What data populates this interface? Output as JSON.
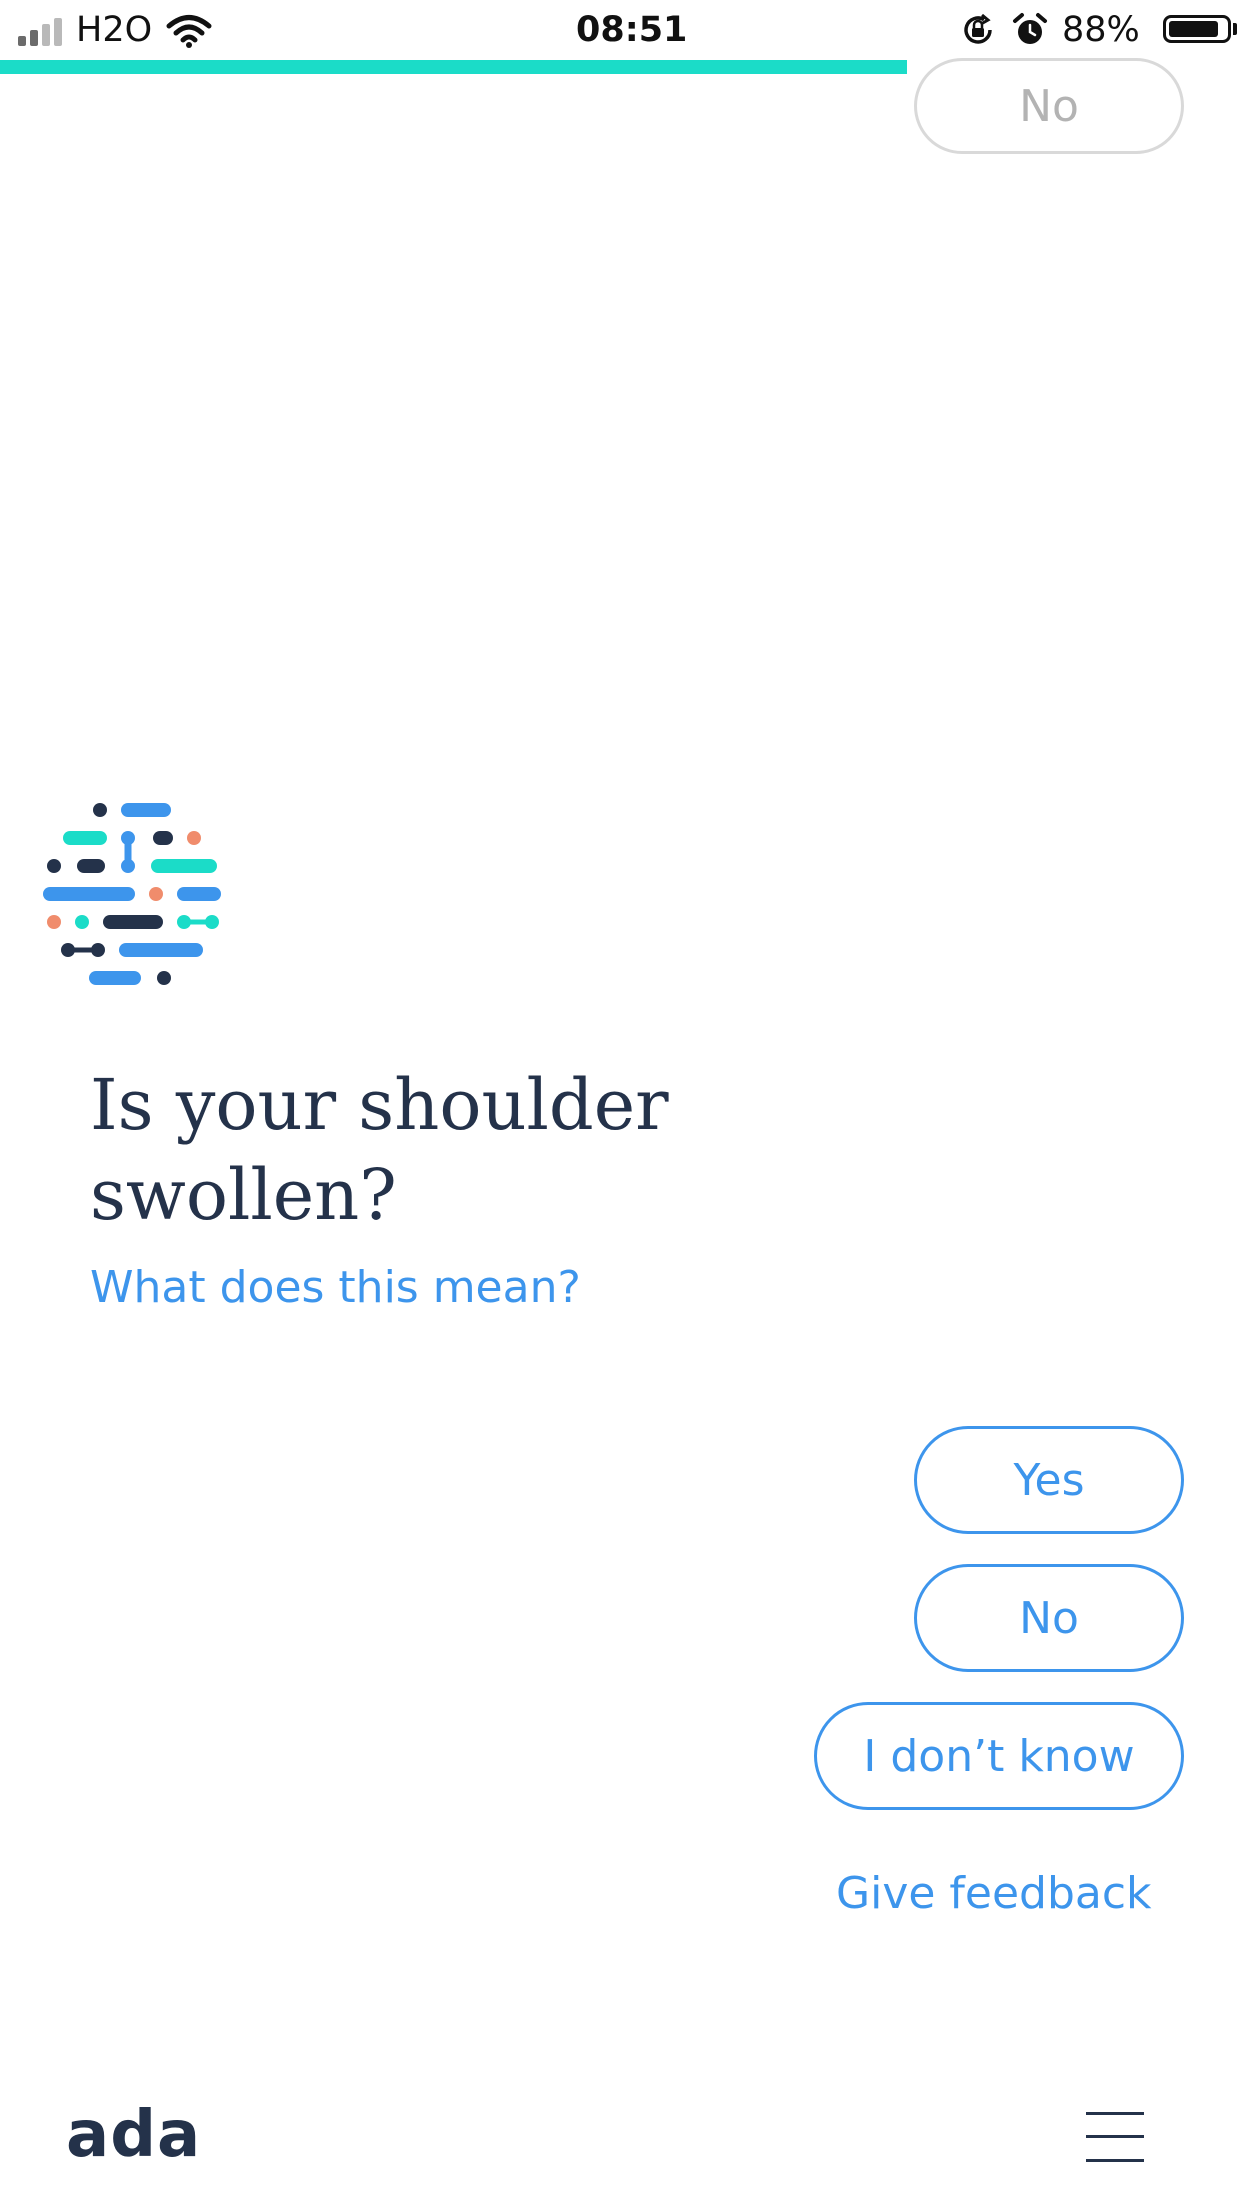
{
  "status_bar": {
    "carrier": "H2O",
    "time": "08:51",
    "battery": "88%",
    "battery_level": 0.88,
    "icons": [
      "signal-icon",
      "wifi-icon",
      "rotation-lock-icon",
      "alarm-icon",
      "battery-icon"
    ]
  },
  "progress": {
    "value": 0.73,
    "color": "#1bdcc8"
  },
  "previous_answer": {
    "label": "No"
  },
  "assistant": {
    "avatar_icon": "ada-dots-logo-icon"
  },
  "question": {
    "text": "Is your shoulder swollen?",
    "help_link": "What does this mean?"
  },
  "answers": [
    {
      "label": "Yes"
    },
    {
      "label": "No"
    },
    {
      "label": "I don’t know"
    }
  ],
  "feedback_link": "Give feedback",
  "footer": {
    "brand": "ada",
    "menu_icon": "hamburger-menu-icon"
  },
  "colors": {
    "accent": "#3d95ec",
    "text_dark": "#24324a",
    "teal": "#1bdcc8",
    "coral": "#f08c6c",
    "muted": "#b3b3b3"
  }
}
